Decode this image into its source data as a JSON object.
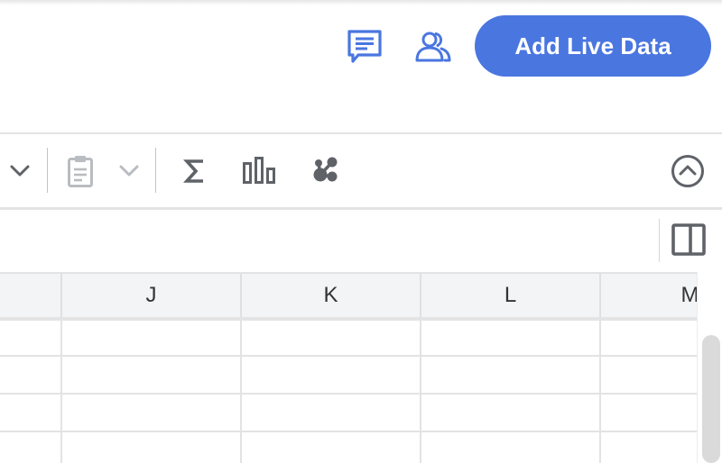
{
  "header": {
    "comments_icon": "comment-icon",
    "share_icon": "people-icon",
    "live_data_button": "Add Live Data",
    "accent_color": "#4a76e0"
  },
  "toolbar": {
    "icons": [
      "chevron-down-icon",
      "clipboard-icon",
      "chevron-down-icon",
      "sigma-icon",
      "bar-chart-icon",
      "share-nodes-icon",
      "collapse-up-icon"
    ]
  },
  "formula_bar": {
    "panel_icon": "side-panel-icon"
  },
  "grid": {
    "columns": [
      "J",
      "K",
      "L",
      "M"
    ]
  }
}
